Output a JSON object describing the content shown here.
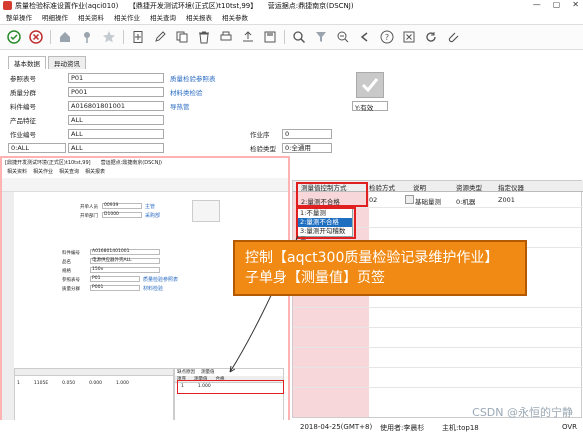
{
  "window": {
    "title": "质量检验标准设置作业(aqci010)　　【鼎捷开发测试环境(正式区)t10tst,99】　　营运据点:鼎捷南京(DSCNJ)",
    "controls": [
      "—",
      "▢",
      "✕"
    ]
  },
  "menubar": [
    "整单操作",
    "明细操作",
    "相关资料",
    "相关作业",
    "相关查询",
    "相关报表",
    "相关参数"
  ],
  "toolbar": {
    "icons": [
      "check-circle-icon",
      "cancel-circle-icon",
      "home-icon",
      "pin-icon",
      "star-icon",
      "new-doc-icon",
      "edit-icon",
      "copy-icon",
      "delete-icon",
      "print-icon",
      "export-icon",
      "save-icon",
      "search-icon",
      "filter-icon",
      "zoom-icon",
      "back-icon",
      "help-icon",
      "close-icon",
      "refresh-icon",
      "attach-icon"
    ]
  },
  "tabs": [
    "基本数据",
    "异动资讯"
  ],
  "form": {
    "rows": [
      {
        "label": "参照表号",
        "value": "P01",
        "link": "质量检验参照表"
      },
      {
        "label": "质量分群",
        "value": "P001",
        "link": "材料类检验"
      },
      {
        "label": "料件编号",
        "value": "A016801801001",
        "link": "导热管"
      },
      {
        "label": "产品特征",
        "value": "ALL",
        "link": ""
      },
      {
        "label": "作业编号",
        "value": "ALL",
        "link": ""
      },
      {
        "label": "0:ALL",
        "value": "ALL",
        "link": ""
      }
    ],
    "right_labels": [
      {
        "label": "作业序",
        "value": "0"
      },
      {
        "label": "检验类型",
        "value": "0:全通用"
      }
    ],
    "mode": "Y:有效"
  },
  "grid": {
    "columns": [
      "测量值控制方式",
      "检验方式",
      "说明",
      "资源类型",
      "指定仪器"
    ],
    "row": {
      "control": "2:量测不合格",
      "method": "02",
      "desc": "基础量测",
      "resource": "0:机器",
      "instrument": "Z001"
    }
  },
  "dropdown": {
    "options": [
      "1:不量测",
      "2:量测不合格",
      "3:量测开勾稽数量"
    ],
    "selected": 1
  },
  "callout": {
    "line1": "控制【aqct300质量检验记录维护作业】",
    "line2": "子单身【测量值】页签"
  },
  "inset": {
    "title": "[鼎捷开发测试环境(正式区)t10tst,99]　　营运据点:鼎捷南京(DSCNJ)",
    "menu": [
      "相关资料",
      "相关作业",
      "相关查询",
      "相关报表"
    ],
    "fields": [
      {
        "label": "开单人员",
        "value": "00939"
      },
      {
        "label": "开单部门",
        "value": "D1000"
      },
      {
        "label": "料件编号",
        "value": "A016801401001"
      },
      {
        "label": "品名",
        "value": "电源供应器外壳ALL"
      },
      {
        "label": "规格",
        "value": "150v"
      },
      {
        "label": "参照表号",
        "value": "P01"
      },
      {
        "label": "质量分群",
        "value": "P001"
      }
    ],
    "links": [
      "主管",
      "采购部",
      "材料检验",
      "质量检验参照表"
    ],
    "grid_row": [
      "1",
      "1105E",
      "0.050",
      "0.000",
      "1.000"
    ],
    "sub_tabs": [
      "缺点原因",
      "测量值"
    ],
    "sub_cols": [
      "项序",
      "测量值",
      "合格"
    ],
    "sub_row": [
      "1",
      "1.000"
    ]
  },
  "status": {
    "left": "2018-04-25(GMT+8)",
    "user": "使用者:李晨杉",
    "db": "主机:top18",
    "ovr": "OVR"
  },
  "watermark": "CSDN @永恒的宁静"
}
